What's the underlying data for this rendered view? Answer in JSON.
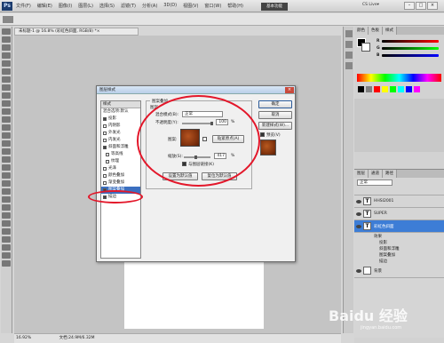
{
  "app": {
    "logo": "Ps"
  },
  "menu": [
    "文件(F)",
    "编辑(E)",
    "图像(I)",
    "图层(L)",
    "选择(S)",
    "滤镜(T)",
    "分析(A)",
    "3D(D)",
    "视图(V)",
    "窗口(W)",
    "帮助(H)"
  ],
  "header": {
    "essentials": "基本功能",
    "cslive": "CS Live▾",
    "min": "–",
    "max": "□",
    "close": "×"
  },
  "document": {
    "tab": "未标题-1 @ 16.8% (彩虹色斜面, RGB/8) *×"
  },
  "status": {
    "zoom": "16.92%",
    "doc": "文档:24.9M/6.32M"
  },
  "panels": {
    "color_tabs": [
      "颜色",
      "色板",
      "样式"
    ],
    "slider_labels": [
      "R",
      "G",
      "B"
    ],
    "swatch_colors": [
      "#000000",
      "#7f7f7f",
      "#ff0000",
      "#ffff00",
      "#00ff00",
      "#00ffff",
      "#0000ff",
      "#ff00ff"
    ],
    "layer_tabs": [
      "图层",
      "通道",
      "路径"
    ],
    "blend_mode": "正常",
    "layers": [
      {
        "name": "HHSI2001"
      },
      {
        "name": "SUPER"
      },
      {
        "name": "彩虹色斜面",
        "active": true
      }
    ],
    "effects_label": "效果",
    "effects": [
      "投影",
      "斜面和浮雕",
      "图案叠加",
      "描边"
    ],
    "bg_layer": "背景"
  },
  "dialog": {
    "title": "图层样式",
    "close": "×",
    "list_head": "样式",
    "list_items": [
      {
        "label": "混合选项:默认",
        "checked": false
      },
      {
        "label": "投影",
        "checked": true
      },
      {
        "label": "内阴影",
        "checked": false
      },
      {
        "label": "外发光",
        "checked": false
      },
      {
        "label": "内发光",
        "checked": false
      },
      {
        "label": "斜面和浮雕",
        "checked": true
      },
      {
        "label": "等高线",
        "checked": false,
        "sub": true
      },
      {
        "label": "纹理",
        "checked": false,
        "sub": true
      },
      {
        "label": "光泽",
        "checked": false
      },
      {
        "label": "颜色叠加",
        "checked": false
      },
      {
        "label": "渐变叠加",
        "checked": false
      },
      {
        "label": "图案叠加",
        "checked": true,
        "selected": true
      },
      {
        "label": "描边",
        "checked": true
      }
    ],
    "group_title": "图案叠加",
    "group_sub": "图案",
    "blend_label": "混合模式(B):",
    "blend_value": "正常",
    "opacity_label": "不透明度(Y):",
    "opacity_value": "100",
    "pattern_label": "图案:",
    "snap_origin": "贴紧原点(A)",
    "scale_label": "缩放(S):",
    "scale_value": "417",
    "percent": "%",
    "link_label": "与图层链接(K)",
    "default_btn": "设置为默认值",
    "reset_btn": "复位为默认值",
    "ok": "确定",
    "cancel": "取消",
    "new_style": "新建样式(W)...",
    "preview_label": "预览(V)"
  },
  "watermark": {
    "text": "Baidu 经验",
    "sub": "jingyan.baidu.com"
  }
}
